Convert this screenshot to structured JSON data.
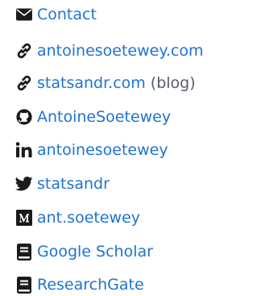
{
  "links": [
    {
      "icon": "envelope-icon",
      "label": "Contact",
      "suffix": ""
    },
    {
      "icon": "link-icon",
      "label": "antoinesoetewey.com",
      "suffix": ""
    },
    {
      "icon": "link-icon",
      "label": "statsandr.com",
      "suffix": "(blog)"
    },
    {
      "icon": "github-icon",
      "label": "AntoineSoetewey",
      "suffix": ""
    },
    {
      "icon": "linkedin-icon",
      "label": "antoinesoetewey",
      "suffix": ""
    },
    {
      "icon": "twitter-icon",
      "label": "statsandr",
      "suffix": ""
    },
    {
      "icon": "medium-icon",
      "label": "ant.soetewey",
      "suffix": ""
    },
    {
      "icon": "book-icon",
      "label": "Google Scholar",
      "suffix": ""
    },
    {
      "icon": "book-icon",
      "label": "ResearchGate",
      "suffix": ""
    }
  ],
  "colors": {
    "link": "#1f73d1",
    "icon": "#1b1b1b",
    "suffix": "#555c66"
  }
}
